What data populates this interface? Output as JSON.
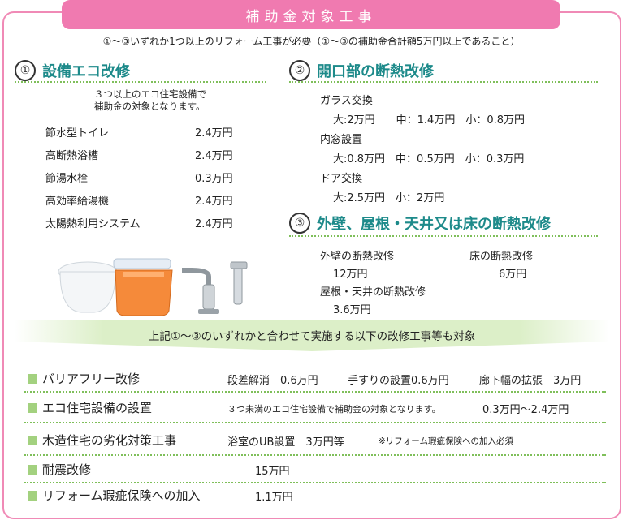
{
  "title": "補助金対象工事",
  "top_note": "①〜③いずれか1つ以上のリフォーム工事が必要（①〜③の補助金合計額5万円以上であること）",
  "section1": {
    "num": "①",
    "heading": "設備エコ改修",
    "note_line1": "３つ以上のエコ住宅設備で",
    "note_line2": "補助金の対象となります。",
    "items": [
      {
        "name": "節水型トイレ",
        "price": "2.4万円"
      },
      {
        "name": "高断熱浴槽",
        "price": "2.4万円"
      },
      {
        "name": "節湯水栓",
        "price": "0.3万円"
      },
      {
        "name": "高効率給湯機",
        "price": "2.4万円"
      },
      {
        "name": "太陽熱利用システム",
        "price": "2.4万円"
      }
    ]
  },
  "section2": {
    "num": "②",
    "heading": "開口部の断熱改修",
    "glass_label": "ガラス交換",
    "glass_values": "大:2万円　　中：1.4万円　小：0.8万円",
    "inner_label": "内窓設置",
    "inner_values": "大:0.8万円　中：0.5万円　小：0.3万円",
    "door_label": "ドア交換",
    "door_values": "大:2.5万円　小：2万円"
  },
  "section3": {
    "num": "③",
    "heading": "外壁、屋根・天井又は床の断熱改修",
    "wall_label": "外壁の断熱改修",
    "wall_value": "12万円",
    "floor_label": "床の断熱改修",
    "floor_value": "6万円",
    "roof_label": "屋根・天井の断熱改修",
    "roof_value": "3.6万円"
  },
  "banner": "上記①〜③のいずれかと合わせて実施する以下の改修工事等も対象",
  "extras": [
    {
      "label": "バリアフリー改修",
      "v1": "段差解消　0.6万円",
      "v2": "手すりの設置0.6万円",
      "v3": "廊下幅の拡張　3万円"
    },
    {
      "label": "エコ住宅設備の設置",
      "v1": "３つ未満のエコ住宅設備で補助金の対象となります。",
      "v2": "0.3万円〜2.4万円"
    },
    {
      "label": "木造住宅の劣化対策工事",
      "v1": "浴室のUB設置　3万円等",
      "v2": "※リフォーム瑕疵保険への加入必須"
    },
    {
      "label": "耐震改修",
      "v1": "15万円"
    },
    {
      "label": "リフォーム瑕疵保険への加入",
      "v1": "1.1万円"
    }
  ],
  "colors": {
    "accent_pink": "#f07ab0",
    "heading_teal": "#1d8a8a",
    "dot_green": "#7fbf5a",
    "banner_green": "#dcefc8"
  },
  "icons": [
    "toilet-image",
    "bathtub-image",
    "faucet-image"
  ]
}
